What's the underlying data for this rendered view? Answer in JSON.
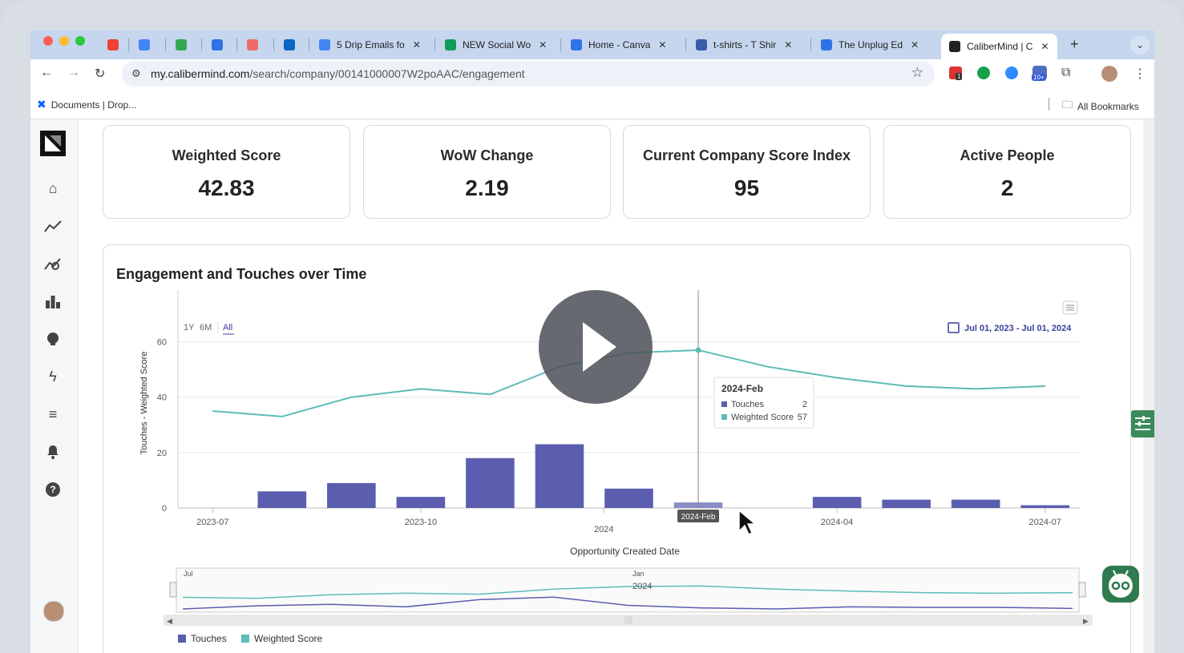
{
  "browser": {
    "tabs": [
      {
        "title": "",
        "favicon": "gmail-icon",
        "color": "#ea4335"
      },
      {
        "title": "",
        "favicon": "calendar-icon",
        "color": "#4285f4"
      },
      {
        "title": "",
        "favicon": "drive-icon",
        "color": "#34a853"
      },
      {
        "title": "",
        "favicon": "canva-icon",
        "color": "#2f72e8"
      },
      {
        "title": "",
        "favicon": "asana-icon",
        "color": "#f06a6a"
      },
      {
        "title": "",
        "favicon": "linkedin-icon",
        "color": "#0a66c2"
      },
      {
        "title": "5 Drip Emails fo",
        "favicon": "docs-icon",
        "color": "#4285f4"
      },
      {
        "title": "NEW Social Wo",
        "favicon": "sheets-icon",
        "color": "#0f9d58"
      },
      {
        "title": "Home - Canva",
        "favicon": "canva-icon",
        "color": "#2f72e8"
      },
      {
        "title": "t-shirts - T Shir",
        "favicon": "printer-icon",
        "color": "#3b5ba9"
      },
      {
        "title": "The Unplug Ed",
        "favicon": "canva-icon",
        "color": "#2f72e8"
      },
      {
        "title": "CaliberMind | C",
        "favicon": "calibermind-icon",
        "color": "#222222"
      }
    ],
    "url_domain": "my.calibermind.com",
    "url_path": "/search/company/00141000007W2poAAC/engagement",
    "bookmark": "Documents | Drop...",
    "all_bookmarks": "All Bookmarks",
    "extension_badges": [
      "1",
      "10+"
    ]
  },
  "sidebar": {
    "items": [
      "logo-icon",
      "home-icon",
      "trend-icon",
      "analytics-icon",
      "bar-chart-icon",
      "brain-icon",
      "lightning-icon",
      "list-icon",
      "bell-icon",
      "help-icon"
    ]
  },
  "cards": [
    {
      "label": "Weighted Score",
      "value": "42.83"
    },
    {
      "label": "WoW Change",
      "value": "2.19"
    },
    {
      "label": "Current Company Score Index",
      "value": "95"
    },
    {
      "label": "Active People",
      "value": "2"
    }
  ],
  "chart_title": "Engagement and Touches over Time",
  "range_buttons": [
    "1Y",
    "6M",
    "All"
  ],
  "date_range": "Jul 01, 2023 - Jul 01, 2024",
  "tooltip": {
    "title": "2024-Feb",
    "rows": [
      {
        "name": "Touches",
        "value": "2"
      },
      {
        "name": "Weighted Score",
        "value": "57"
      }
    ]
  },
  "crosshair_label": "2024-Feb",
  "navigator": {
    "labels": [
      "Jul",
      "Jan",
      "2024"
    ]
  },
  "colors": {
    "touches": "#5b5eae",
    "weighted": "#5cbcb6",
    "accent": "#3a3f9a"
  },
  "chart_data": {
    "type": "bar",
    "ylabel": "Touches - Weighted Score",
    "xlabel": "Opportunity Created Date",
    "ylim": [
      0,
      70
    ],
    "yticks": [
      0,
      20,
      40,
      60
    ],
    "xticks": [
      "2023-07",
      "2023-10",
      "2024",
      "2024-04",
      "2024-07"
    ],
    "categories": [
      "2023-07",
      "2023-08",
      "2023-09",
      "2023-10",
      "2023-11",
      "2023-12",
      "2024-01",
      "2024-02",
      "2024-03",
      "2024-04",
      "2024-05",
      "2024-06",
      "2024-07"
    ],
    "series": [
      {
        "name": "Touches",
        "type": "bar",
        "values": [
          0,
          6,
          9,
          4,
          18,
          23,
          7,
          2,
          0,
          4,
          3,
          3,
          1
        ]
      },
      {
        "name": "Weighted Score",
        "type": "line",
        "values": [
          35,
          33,
          40,
          43,
          41,
          51,
          56,
          57,
          51,
          47,
          44,
          43,
          44
        ]
      }
    ],
    "legend": "bottom-left"
  }
}
